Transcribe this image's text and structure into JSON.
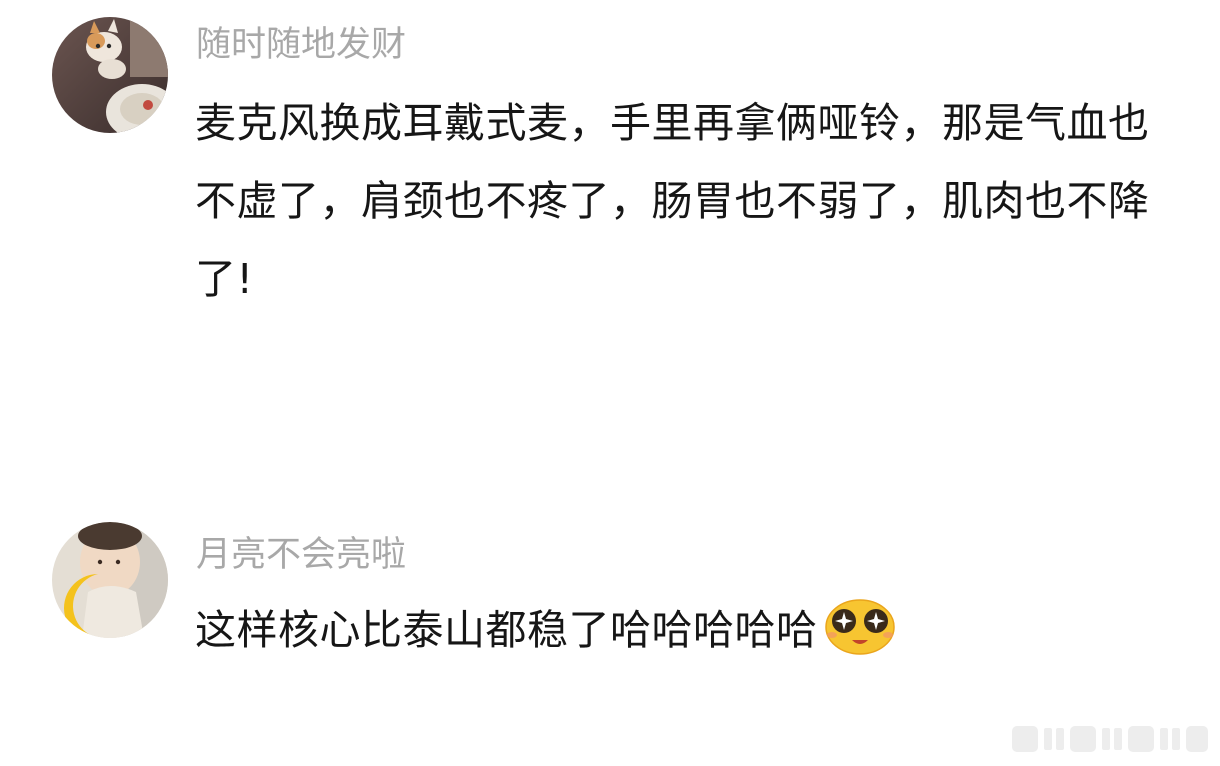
{
  "comments": [
    {
      "username": "随时随地发财",
      "avatar_icon": "cat-photo-avatar",
      "text": "麦克风换成耳戴式麦，手里再拿俩哑铃，那是气血也不虚了，肩颈也不疼了，肠胃也不弱了，肌肉也不降了!"
    },
    {
      "username": "月亮不会亮啦",
      "avatar_icon": "moon-photo-avatar",
      "text": "这样核心比泰山都稳了哈哈哈哈哈",
      "emoji_icon": "starry-eyes-emoji-icon"
    }
  ],
  "colors": {
    "username": "#a8a8a8",
    "text": "#161616",
    "background": "#ffffff"
  }
}
